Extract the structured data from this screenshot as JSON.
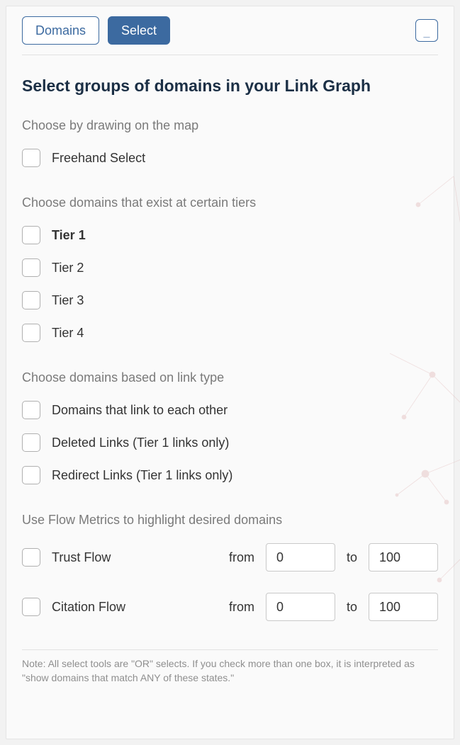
{
  "tabs": {
    "domains": "Domains",
    "select": "Select"
  },
  "collapse_label": "_",
  "title": "Select groups of domains in your Link Graph",
  "sections": {
    "draw": {
      "label": "Choose by drawing on the map",
      "items": [
        "Freehand Select"
      ]
    },
    "tiers": {
      "label": "Choose domains that exist at certain tiers",
      "items": [
        "Tier 1",
        "Tier 2",
        "Tier 3",
        "Tier 4"
      ]
    },
    "link_type": {
      "label": "Choose domains based on link type",
      "items": [
        "Domains that link to each other",
        "Deleted Links (Tier 1 links only)",
        "Redirect Links (Tier 1 links only)"
      ]
    },
    "flow": {
      "label": "Use Flow Metrics to highlight desired domains",
      "from_label": "from",
      "to_label": "to",
      "metrics": [
        {
          "name": "Trust Flow",
          "from": "0",
          "to": "100"
        },
        {
          "name": "Citation Flow",
          "from": "0",
          "to": "100"
        }
      ]
    }
  },
  "footer_note": "Note: All select tools are \"OR\" selects. If you check more than one box, it is interpreted as \"show domains that match ANY of these states.\""
}
